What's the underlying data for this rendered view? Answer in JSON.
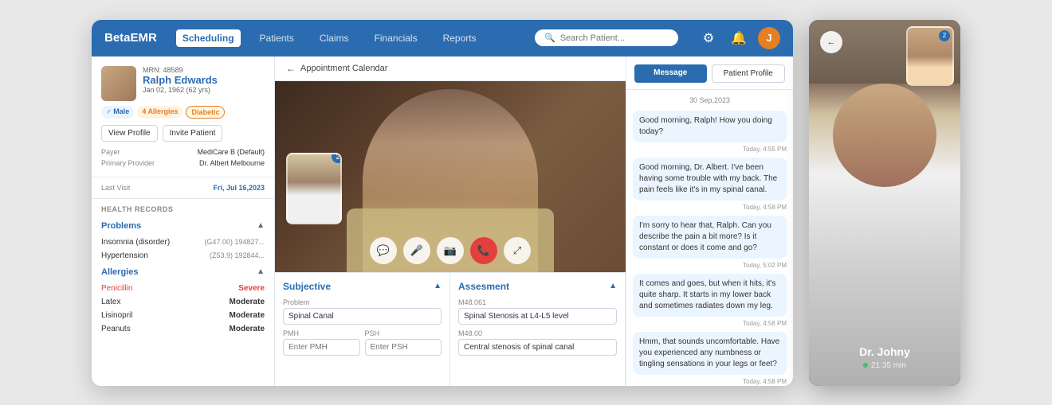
{
  "brand": "BetaEMR",
  "nav": {
    "items": [
      {
        "label": "Scheduling",
        "active": true
      },
      {
        "label": "Patients",
        "active": false
      },
      {
        "label": "Claims",
        "active": false
      },
      {
        "label": "Financials",
        "active": false
      },
      {
        "label": "Reports",
        "active": false
      }
    ],
    "search_placeholder": "Search Patient...",
    "user_initial": "J"
  },
  "patient": {
    "mrn": "MRN: 48589",
    "name": "Ralph Edwards",
    "dob": "Jan 02, 1962 (62 yrs)",
    "tags": [
      "Male",
      "4 Allergies",
      "Diabetic"
    ],
    "btn_view": "View Profile",
    "btn_invite": "Invite Patient",
    "payer_label": "Payer",
    "payer_value": "MediCare B (Default)",
    "provider_label": "Primary Provider",
    "provider_value": "Dr. Albert Melbourne",
    "last_visit_label": "Last Visit",
    "last_visit_value": "Fri, Jul 16,2023"
  },
  "health_records": {
    "title": "HEALTH RECORDS",
    "problems_label": "Problems",
    "problems": [
      {
        "name": "Insomnia (disorder)",
        "code": "(G47.00) 194827..."
      },
      {
        "name": "Hypertension",
        "code": "(Z53.9) 192844..."
      }
    ],
    "allergies_label": "Allergies",
    "allergies": [
      {
        "name": "Penicillin",
        "level": "Severe"
      },
      {
        "name": "Latex",
        "level": "Moderate"
      },
      {
        "name": "Lisinopril",
        "level": "Moderate"
      },
      {
        "name": "Peanuts",
        "level": "Moderate"
      }
    ]
  },
  "breadcrumb": "Appointment Calendar",
  "video": {
    "mini_badge": "2"
  },
  "subjective": {
    "title": "Subjective",
    "problem_label": "Problem",
    "problem_value": "Spinal Canal",
    "pmh_label": "PMH",
    "psh_label": "PSH",
    "pmh_placeholder": "Enter PMH",
    "psh_placeholder": "Enter PSH"
  },
  "assessment": {
    "title": "Assesment",
    "m48061_label": "M48.061",
    "m48061_value": "Spinal Stenosis at L4-L5 level",
    "m4800_label": "M48.00",
    "m4800_value": "Central stenosis of spinal canal"
  },
  "chat": {
    "tab_message": "Message",
    "tab_profile": "Patient Profile",
    "date": "30 Sep,2023",
    "messages": [
      {
        "text": "Good morning, Ralph! How you doing today?",
        "time": "Today, 4:55 PM",
        "from": "doctor"
      },
      {
        "text": "Good morning, Dr. Albert. I've been having some trouble with my back. The pain feels like it's in my spinal canal.",
        "time": "Today, 4:58 PM",
        "from": "patient"
      },
      {
        "text": "I'm sorry to hear that, Ralph. Can you describe the pain a bit more? Is it constant or does it come and go?",
        "time": "Today, 5:02 PM",
        "from": "doctor"
      },
      {
        "text": "It comes and goes, but when it hits, it's quite sharp. It starts in my lower back and sometimes radiates down my leg.",
        "time": "Today, 4:58 PM",
        "from": "patient"
      },
      {
        "text": "Hmm, that sounds uncomfortable. Have you experienced any numbness or tingling sensations in your legs or feet?",
        "time": "Today, 4:58 PM",
        "from": "doctor"
      }
    ]
  },
  "right_video": {
    "doctor_name": "Dr. Johny",
    "status_time": "21:35 min",
    "mini_badge": "2"
  }
}
